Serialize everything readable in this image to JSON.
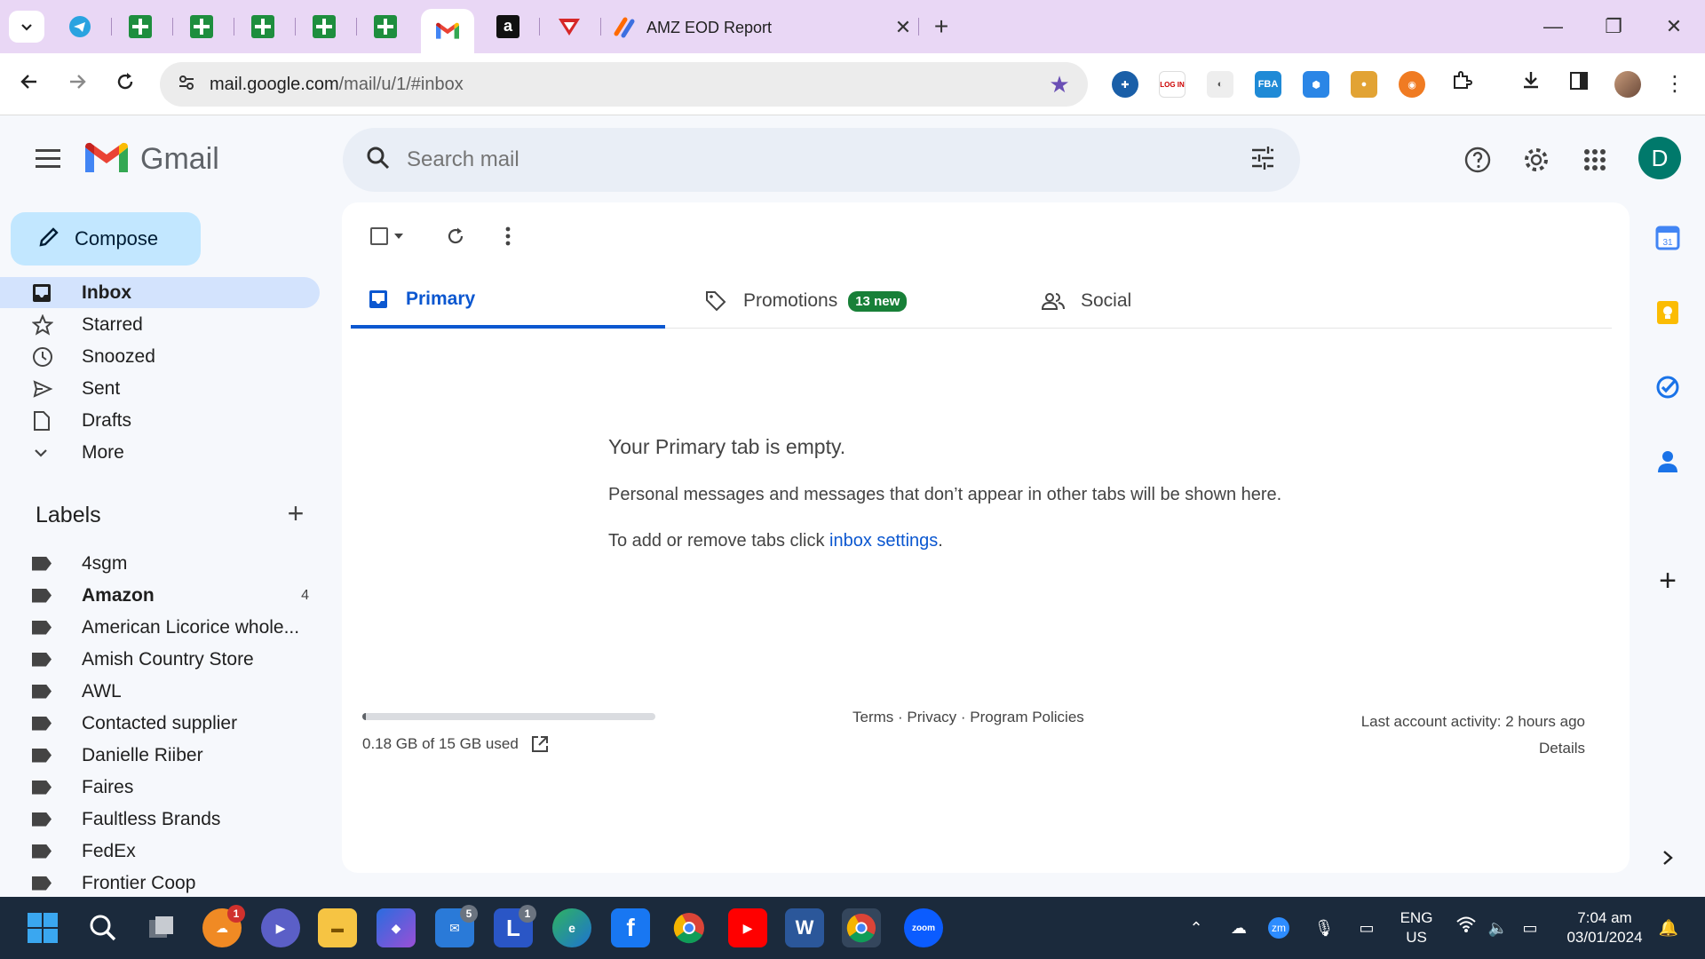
{
  "browser": {
    "active_tab_title": "AMZ EOD Report",
    "url_host": "mail.google.com",
    "url_path": "/mail/u/1/#inbox"
  },
  "gmail": {
    "brand": "Gmail",
    "search_placeholder": "Search mail",
    "avatar_letter": "D",
    "compose_label": "Compose"
  },
  "nav": [
    {
      "label": "Inbox",
      "icon": "inbox-icon"
    },
    {
      "label": "Starred",
      "icon": "star-icon"
    },
    {
      "label": "Snoozed",
      "icon": "clock-icon"
    },
    {
      "label": "Sent",
      "icon": "send-icon"
    },
    {
      "label": "Drafts",
      "icon": "draft-icon"
    },
    {
      "label": "More",
      "icon": "chevron-down-icon"
    }
  ],
  "labels_heading": "Labels",
  "labels": [
    {
      "name": "4sgm",
      "count": ""
    },
    {
      "name": "Amazon",
      "count": "4"
    },
    {
      "name": "American Licorice whole...",
      "count": ""
    },
    {
      "name": "Amish Country Store",
      "count": ""
    },
    {
      "name": "AWL",
      "count": ""
    },
    {
      "name": "Contacted supplier",
      "count": ""
    },
    {
      "name": "Danielle Riiber",
      "count": ""
    },
    {
      "name": "Faires",
      "count": ""
    },
    {
      "name": "Faultless Brands",
      "count": ""
    },
    {
      "name": "FedEx",
      "count": ""
    },
    {
      "name": "Frontier Coop",
      "count": ""
    }
  ],
  "tabs": {
    "primary": "Primary",
    "promotions": "Promotions",
    "promotions_badge": "13 new",
    "social": "Social"
  },
  "empty": {
    "title": "Your Primary tab is empty.",
    "description": "Personal messages and messages that don’t appear in other tabs will be shown here.",
    "settings_prefix": "To add or remove tabs click ",
    "settings_link": "inbox settings",
    "settings_suffix": "."
  },
  "footer": {
    "storage": "0.18 GB of 15 GB used",
    "storage_used_fraction": 0.012,
    "terms": "Terms",
    "privacy": "Privacy",
    "policies": "Program Policies",
    "dot": "·",
    "activity": "Last account activity: 2 hours ago",
    "details": "Details"
  },
  "taskbar": {
    "badge_1": "1",
    "badge_5": "5",
    "badge_l": "1",
    "lang_1": "ENG",
    "lang_2": "US",
    "time": "7:04 am",
    "date": "03/01/2024"
  },
  "colors": {
    "accent": "#0b57d0",
    "compose_bg": "#c2e7ff",
    "badge_green": "#188038"
  }
}
